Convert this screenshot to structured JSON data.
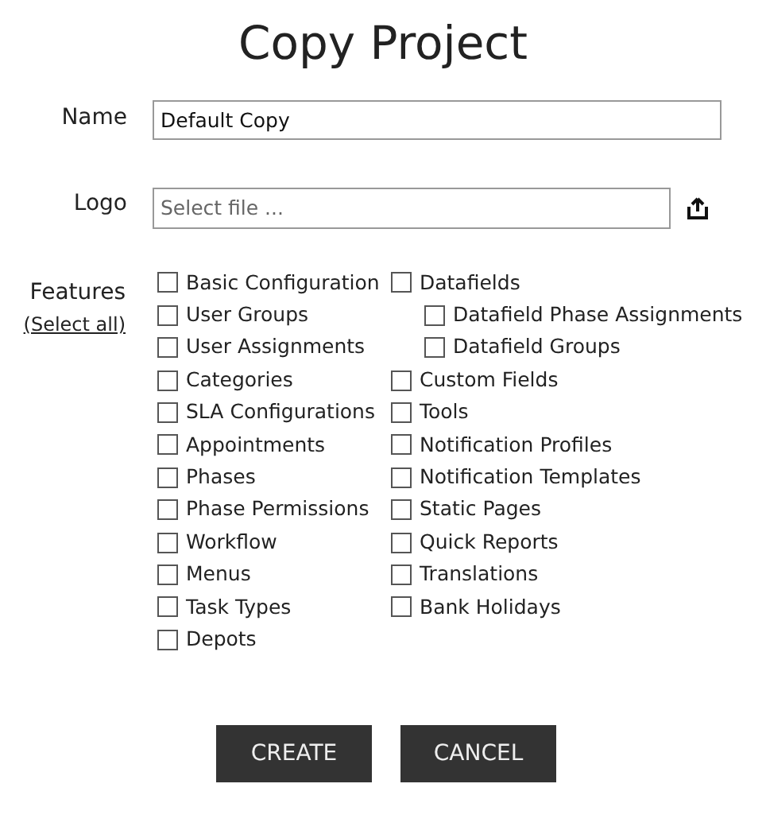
{
  "title": "Copy Project",
  "name_field": {
    "label": "Name",
    "value": "Default Copy"
  },
  "logo_field": {
    "label": "Logo",
    "placeholder": "Select file ..."
  },
  "features": {
    "label": "Features",
    "select_all": "(Select all)",
    "columns": [
      [
        {
          "label": "Basic Configuration",
          "checked": false
        },
        {
          "label": "User Groups",
          "checked": false
        },
        {
          "label": "User Assignments",
          "checked": false
        },
        {
          "label": "Categories",
          "checked": false
        },
        {
          "label": "SLA Configurations",
          "checked": false
        },
        {
          "label": "Appointments",
          "checked": false
        },
        {
          "label": "Phases",
          "checked": false
        },
        {
          "label": "Phase Permissions",
          "checked": false
        },
        {
          "label": "Workflow",
          "checked": false
        },
        {
          "label": "Menus",
          "checked": false
        },
        {
          "label": "Task Types",
          "checked": false
        },
        {
          "label": "Depots",
          "checked": false
        }
      ],
      [
        {
          "label": "Datafields",
          "checked": false,
          "children": [
            {
              "label": "Datafield Phase Assignments",
              "checked": false
            },
            {
              "label": "Datafield Groups",
              "checked": false
            }
          ]
        },
        {
          "label": "Custom Fields",
          "checked": false
        },
        {
          "label": "Tools",
          "checked": false
        },
        {
          "label": "Notification Profiles",
          "checked": false
        },
        {
          "label": "Notification Templates",
          "checked": false
        },
        {
          "label": "Static Pages",
          "checked": false
        },
        {
          "label": "Quick Reports",
          "checked": false
        },
        {
          "label": "Translations",
          "checked": false
        },
        {
          "label": "Bank Holidays",
          "checked": false
        }
      ]
    ]
  },
  "buttons": [
    "CREATE",
    "CANCEL"
  ]
}
